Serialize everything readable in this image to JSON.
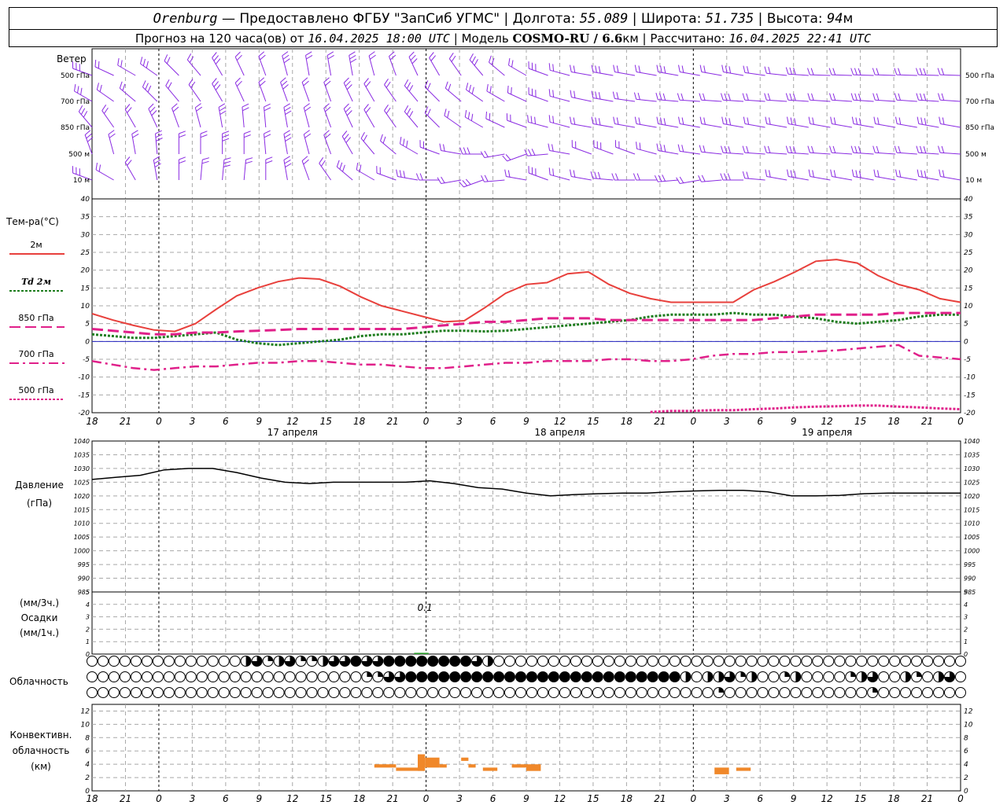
{
  "header": {
    "station": "Orenburg",
    "provider": "— Предоставлено ФГБУ \"ЗапСиб УГМС\"",
    "lon_label": "| Долгота:",
    "lon": "55.089",
    "lat_label": "| Широта:",
    "lat": "51.735",
    "alt_label": "| Высота:",
    "alt": "94",
    "alt_unit": "м",
    "forecast_label": "Прогноз на 120 часа(ов) от",
    "forecast_start": "16.04.2025 18:00 UTC",
    "model_label": "| Модель",
    "model": "COSMO-RU / 6.6",
    "model_unit": "км",
    "calc_label": "| Рассчитано:",
    "calc_time": "16.04.2025 22:41 UTC"
  },
  "labels": {
    "wind": "Ветер",
    "temperature": "Тем-ра(°C)",
    "pressure_1": "Давление",
    "pressure_2": "(гПа)",
    "precip_1": "(мм/3ч.)",
    "precip_2": "Осадки",
    "precip_3": "(мм/1ч.)",
    "cloud": "Облачность",
    "conv_1": "Конвективн.",
    "conv_2": "облачность",
    "conv_3": "(км)"
  },
  "colors": {
    "wind": "#8a2be2",
    "t2m": "#e8403c",
    "td2m": "#1e7d1e",
    "t850": "#e0208a",
    "t700": "#e0208a",
    "t500": "#e0208a",
    "zero_line": "#2020c0",
    "pressure": "#000000",
    "precip": "#2ca02c",
    "convective": "#f0882a",
    "grid": "#a8a8a8"
  },
  "chart_data": [
    {
      "type": "wind_barbs",
      "name": "Ветер",
      "levels": [
        "500 гПа",
        "700 гПа",
        "850 гПа",
        "500 м",
        "10 м"
      ],
      "start_hour_utc": 18,
      "step_hours": 1,
      "hours": 121
    },
    {
      "type": "line",
      "ylabel": "Тем-ра(°C)",
      "ylim": [
        -20,
        40
      ],
      "yticks": [
        40,
        35,
        30,
        25,
        20,
        15,
        10,
        5,
        0,
        -5,
        -10,
        -15,
        -20
      ],
      "xticks": [
        "18",
        "21",
        "0",
        "3",
        "6",
        "9",
        "12",
        "15",
        "18",
        "21",
        "0",
        "3",
        "6",
        "9",
        "12",
        "15",
        "18",
        "21",
        "0",
        "3",
        "6",
        "9",
        "12",
        "15",
        "18",
        "21",
        "0"
      ],
      "day_labels": [
        "17 апреля",
        "18 апреля",
        "19 апреля"
      ],
      "x_step_hours": 3,
      "series": [
        {
          "name": "2м",
          "key": "t2m",
          "style": "solid",
          "values": [
            7.8,
            6.0,
            4.5,
            3.2,
            2.8,
            5.0,
            9.0,
            12.8,
            15.0,
            16.8,
            17.8,
            17.5,
            15.5,
            12.5,
            10.0,
            8.5,
            7.0,
            5.5,
            5.8,
            9.5,
            13.5,
            16.0,
            16.5,
            19.0,
            19.5,
            16.0,
            13.5,
            12.0,
            11.0,
            11.0,
            11.0,
            11.0,
            14.5,
            16.8,
            19.5,
            22.5,
            23.0,
            22.0,
            18.5,
            16.0,
            14.5,
            12.0,
            11.0
          ]
        },
        {
          "name": "Td 2м",
          "key": "td2m",
          "style": "dotted",
          "values": [
            2.0,
            1.5,
            1.0,
            1.0,
            1.5,
            2.0,
            2.5,
            0.5,
            -0.5,
            -1.0,
            -0.5,
            0.0,
            0.5,
            1.5,
            2.0,
            2.0,
            2.5,
            3.0,
            3.0,
            2.8,
            3.0,
            3.5,
            4.0,
            4.5,
            5.0,
            5.5,
            6.0,
            7.0,
            7.5,
            7.5,
            7.5,
            8.0,
            7.5,
            7.5,
            7.0,
            6.5,
            5.5,
            5.0,
            5.5,
            6.0,
            7.0,
            7.5,
            7.5
          ]
        },
        {
          "name": "850 гПа",
          "key": "t850",
          "style": "dashed",
          "values": [
            3.5,
            3.0,
            2.5,
            2.0,
            2.0,
            2.5,
            2.5,
            2.8,
            3.0,
            3.2,
            3.5,
            3.5,
            3.5,
            3.5,
            3.5,
            3.5,
            4.0,
            4.5,
            5.0,
            5.5,
            5.5,
            6.0,
            6.5,
            6.5,
            6.5,
            6.0,
            6.0,
            6.0,
            6.0,
            6.0,
            6.0,
            6.0,
            6.0,
            6.5,
            7.0,
            7.5,
            7.5,
            7.5,
            7.5,
            8.0,
            8.0,
            8.0,
            8.0
          ]
        },
        {
          "name": "700 гПа",
          "key": "t700",
          "style": "dashdot",
          "values": [
            -5.5,
            -6.5,
            -7.5,
            -8.0,
            -7.5,
            -7.0,
            -7.0,
            -6.5,
            -6.0,
            -6.0,
            -5.5,
            -5.5,
            -6.0,
            -6.5,
            -6.5,
            -7.0,
            -7.5,
            -7.5,
            -7.0,
            -6.5,
            -6.0,
            -6.0,
            -5.5,
            -5.5,
            -5.5,
            -5.0,
            -5.0,
            -5.5,
            -5.5,
            -5.0,
            -4.0,
            -3.5,
            -3.5,
            -3.0,
            -3.0,
            -2.8,
            -2.5,
            -2.0,
            -1.5,
            -1.0,
            -4.0,
            -4.5,
            -5.0
          ]
        },
        {
          "name": "500 гПа",
          "key": "t500",
          "style": "dotted",
          "values": [
            null,
            null,
            null,
            null,
            null,
            null,
            null,
            null,
            null,
            null,
            null,
            null,
            null,
            null,
            null,
            null,
            null,
            null,
            null,
            null,
            null,
            null,
            null,
            null,
            null,
            null,
            null,
            -19.8,
            -19.5,
            -19.5,
            -19.3,
            -19.3,
            -19.0,
            -18.8,
            -18.5,
            -18.3,
            -18.2,
            -18.0,
            -18.0,
            -18.3,
            -18.5,
            -18.8,
            -19.0
          ]
        }
      ]
    },
    {
      "type": "line",
      "ylabel": "Давление (гПа)",
      "ylim": [
        985,
        1040
      ],
      "yticks": [
        1040,
        1035,
        1030,
        1025,
        1020,
        1015,
        1010,
        1005,
        1000,
        995,
        990,
        985
      ],
      "series": [
        {
          "name": "Давление",
          "values": [
            1026.0,
            1026.8,
            1027.5,
            1029.5,
            1030.0,
            1030.0,
            1028.5,
            1026.5,
            1025.0,
            1024.5,
            1025.0,
            1025.0,
            1025.0,
            1025.0,
            1025.5,
            1024.5,
            1023.0,
            1022.5,
            1021.0,
            1020.0,
            1020.5,
            1020.8,
            1021.0,
            1021.0,
            1021.5,
            1021.8,
            1022.0,
            1022.0,
            1021.5,
            1020.0,
            1020.0,
            1020.2,
            1020.8,
            1021.0,
            1021.0,
            1021.0,
            1021.0
          ]
        }
      ]
    },
    {
      "type": "bar",
      "ylabel": "Осадки",
      "ylim": [
        0,
        5
      ],
      "yticks": [
        5,
        4,
        3,
        2,
        1,
        0
      ],
      "annotation": "0.1",
      "series": [
        {
          "name": "Осадки",
          "values": [
            0.1
          ]
        }
      ]
    },
    {
      "type": "table",
      "name": "Облачность",
      "rows": 3,
      "columns": 41,
      "note": "symbols: empty circle = clear, quarter/half/three-quarter/full filled = cloud fraction"
    },
    {
      "type": "bar",
      "ylabel": "Конвективн. облачность (км)",
      "ylim": [
        0,
        13
      ],
      "yticks": [
        12,
        10,
        8,
        6,
        4,
        2,
        0
      ],
      "segments": [
        {
          "hour_from": 39,
          "hour_to": 42,
          "base_km": 3.5,
          "top_km": 4.0
        },
        {
          "hour_from": 42,
          "hour_to": 45,
          "base_km": 3.0,
          "top_km": 3.5
        },
        {
          "hour_from": 45,
          "hour_to": 46,
          "base_km": 3.0,
          "top_km": 5.5
        },
        {
          "hour_from": 46,
          "hour_to": 48,
          "base_km": 3.5,
          "top_km": 5.0
        },
        {
          "hour_from": 48,
          "hour_to": 49,
          "base_km": 3.5,
          "top_km": 4.0
        },
        {
          "hour_from": 51,
          "hour_to": 52,
          "base_km": 4.5,
          "top_km": 5.0
        },
        {
          "hour_from": 52,
          "hour_to": 53,
          "base_km": 3.5,
          "top_km": 4.0
        },
        {
          "hour_from": 54,
          "hour_to": 56,
          "base_km": 3.0,
          "top_km": 3.5
        },
        {
          "hour_from": 58,
          "hour_to": 60,
          "base_km": 3.5,
          "top_km": 4.0
        },
        {
          "hour_from": 60,
          "hour_to": 62,
          "base_km": 3.0,
          "top_km": 4.0
        },
        {
          "hour_from": 86,
          "hour_to": 88,
          "base_km": 2.5,
          "top_km": 3.5
        },
        {
          "hour_from": 89,
          "hour_to": 91,
          "base_km": 3.0,
          "top_km": 3.5
        }
      ]
    }
  ]
}
